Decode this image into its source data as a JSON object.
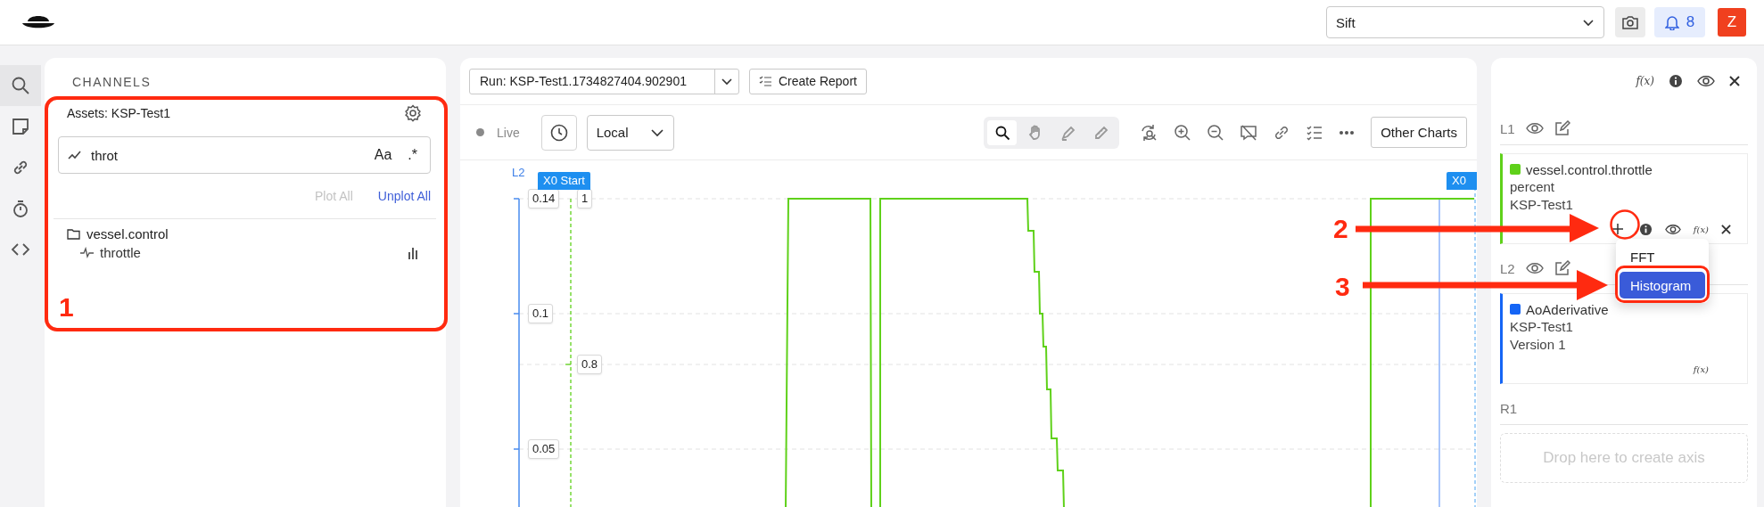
{
  "topbar": {
    "workspace_select": "Sift",
    "notification_count": "8",
    "avatar_initial": "Z"
  },
  "rail": [
    {
      "selected": true
    },
    {
      "selected": false
    },
    {
      "selected": false
    },
    {
      "selected": false
    },
    {
      "selected": false
    }
  ],
  "channels": {
    "title": "CHANNELS",
    "assets_label": "Assets: KSP-Test1",
    "search": {
      "value": "throt",
      "case_toggle": "Aa",
      "regex_toggle": ".*"
    },
    "plot_all": {
      "label": "Plot All",
      "disabled": true
    },
    "unplot_all": {
      "label": "Unplot All",
      "disabled": false
    },
    "tree": [
      {
        "label": "vessel.control",
        "children": [
          {
            "label": "throttle"
          }
        ]
      }
    ]
  },
  "chart_panel": {
    "run_select": "Run: KSP-Test1.1734827404.902901",
    "create_report": "Create Report",
    "live": {
      "label": "Live",
      "on": false
    },
    "timezone_select": "Local",
    "tools": [
      {
        "selected": true
      },
      {
        "selected": false
      },
      {
        "selected": false
      },
      {
        "selected": false
      }
    ],
    "other_charts": "Other Charts",
    "plot": {
      "axes": [
        {
          "label": "L2",
          "ticks": [
            "0.14",
            "0.1",
            "0.05"
          ]
        },
        {
          "ticks": [
            "1",
            "0.8"
          ]
        }
      ],
      "markers": [
        "X0 Start",
        "X0"
      ]
    }
  },
  "right_panel": {
    "function_label": "f(x)",
    "axes": [
      {
        "label": "L1",
        "channel": {
          "name": "vessel.control.throttle",
          "color": "#5fd11a",
          "lines": [
            "percent",
            "KSP-Test1"
          ],
          "actions_visible": true,
          "function_label": "f(x)"
        }
      },
      {
        "label": "L2",
        "channel": {
          "name": "AoAderivative",
          "color": "#1565f5",
          "lines": [
            "KSP-Test1",
            "Version 1"
          ],
          "actions_visible": false,
          "function_label": "f(x)"
        }
      },
      {
        "label": "R1",
        "drop_zone": "Drop here to create axis"
      }
    ],
    "context_menu": [
      {
        "label": "FFT",
        "selected": false
      },
      {
        "label": "Histogram",
        "selected": true
      }
    ]
  },
  "annotations": [
    {
      "label": "1"
    },
    {
      "label": "2"
    },
    {
      "label": "3"
    }
  ]
}
